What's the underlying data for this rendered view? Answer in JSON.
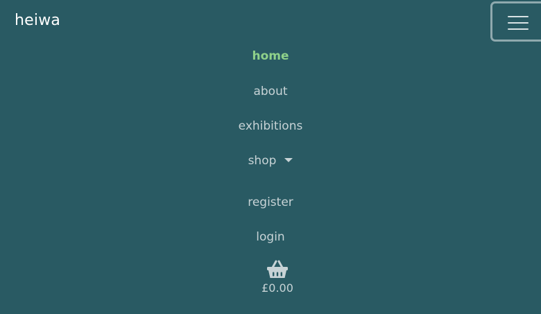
{
  "brand": {
    "name": "heiwa"
  },
  "toggler": {
    "icon": "hamburger-menu-icon"
  },
  "nav": {
    "items": [
      {
        "label": "home",
        "active": true
      },
      {
        "label": "about",
        "active": false
      },
      {
        "label": "exhibitions",
        "active": false
      },
      {
        "label": "shop",
        "active": false,
        "dropdown": true
      },
      {
        "label": "register",
        "active": false
      },
      {
        "label": "login",
        "active": false
      }
    ]
  },
  "basket": {
    "icon": "shopping-basket-icon",
    "total": "£0.00"
  },
  "colors": {
    "background": "#295a63",
    "active_link": "#8fd18a",
    "link": "#c7d3d6",
    "brand": "#ffffff",
    "toggler_border": "#8fa9ae"
  }
}
